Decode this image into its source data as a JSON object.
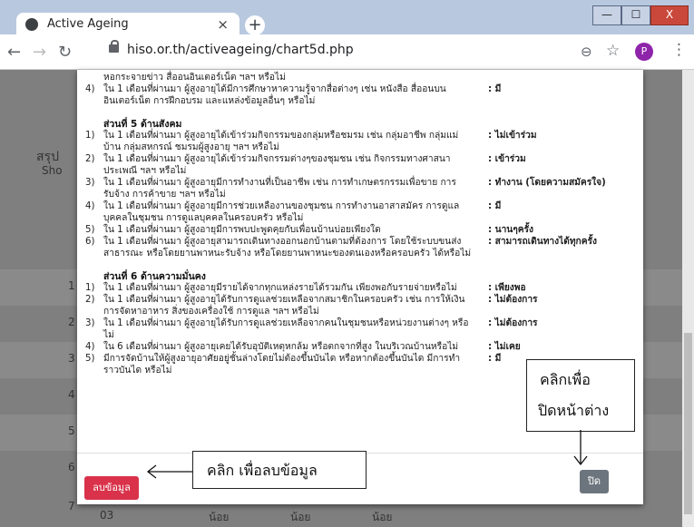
{
  "browser": {
    "tab_title": "Active Ageing",
    "tab_close": "×",
    "new_tab": "+",
    "url": "hiso.or.th/activeageing/chart5d.php",
    "profile_initial": "P",
    "win_min": "—",
    "win_max": "☐",
    "win_close": "X"
  },
  "background": {
    "side_label": "สรุป",
    "show_label": "Sho"
  },
  "modal": {
    "top_rows": [
      {
        "num": "",
        "text": "หอกระจายข่าว สื่ออนอินเตอร์เน็ต ฯลฯ หรือไม่",
        "answer": ""
      },
      {
        "num": "4)",
        "text": "ใน 1 เดือนที่ผ่านมา ผู้สูงอายุได้มีการศึกษาหาความรู้จากสื่อต่างๆ เช่น หนังสือ สื่ออนบน",
        "answer": ": มี"
      },
      {
        "num": "",
        "text": "อินเตอร์เน็ต การฝึกอบรม และแหล่งข้อมูลอื่นๆ หรือไม่",
        "answer": ""
      }
    ],
    "section5": {
      "title": "ส่วนที่ 5 ด้านสังคม",
      "rows": [
        {
          "num": "1)",
          "text": "ใน 1 เดือนที่ผ่านมา ผู้สูงอายุได้เข้าร่วมกิจกรรมของกลุ่มหรือชมรม เช่น กลุ่มอาชีพ กลุ่มแม่",
          "answer": ": ไม่เข้าร่วม"
        },
        {
          "num": "",
          "text": "บ้าน กลุ่มสหกรณ์ ชมรมผู้สูงอายุ ฯลฯ หรือไม่",
          "answer": ""
        },
        {
          "num": "2)",
          "text": "ใน 1 เดือนที่ผ่านมา ผู้สูงอายุได้เข้าร่วมกิจกรรมต่างๆของชุมชน เช่น กิจกรรมทางศาสนา",
          "answer": ": เข้าร่วม"
        },
        {
          "num": "",
          "text": "ประเพณี ฯลฯ หรือไม่",
          "answer": ""
        },
        {
          "num": "3)",
          "text": "ใน 1 เดือนที่ผ่านมา ผู้สูงอายุมีการทำงานที่เป็นอาชีพ เช่น การทำเกษตรกรรมเพื่อขาย การ",
          "answer": ": ทำงาน (โดยความสมัครใจ)"
        },
        {
          "num": "",
          "text": "รับจ้าง การค้าขาย ฯลฯ หรือไม่",
          "answer": ""
        },
        {
          "num": "4)",
          "text": "ใน 1 เดือนที่ผ่านมา ผู้สูงอายุมีการช่วยเหลืองานของชุมชน การทำงานอาสาสมัคร การดูแล",
          "answer": ": มี"
        },
        {
          "num": "",
          "text": "บุคคลในชุมชน การดูแลบุคคลในครอบครัว หรือไม่",
          "answer": ""
        },
        {
          "num": "5)",
          "text": "ใน 1 เดือนที่ผ่านมา ผู้สูงอายุมีการพบปะพูดคุยกับเพื่อนบ้านบ่อยเพียงใด",
          "answer": ": นานๆครั้ง"
        },
        {
          "num": "6)",
          "text": "ใน 1 เดือนที่ผ่านมา ผู้สูงอายุสามารถเดินทางออกนอกบ้านตามที่ต้องการ โดยใช้ระบบขนส่ง",
          "answer": ": สามารถเดินทางได้ทุกครั้ง"
        },
        {
          "num": "",
          "text": "สาธารณะ หรือโดยยานพาหนะรับจ้าง หรือโดยยานพาหนะของตนเองหรือครอบครัว ได้หรือไม่",
          "answer": ""
        }
      ]
    },
    "section6": {
      "title": "ส่วนที่ 6 ด้านความมั่นคง",
      "rows": [
        {
          "num": "1)",
          "text": "ใน 1 เดือนที่ผ่านมา ผู้สูงอายุมีรายได้จากทุกแหล่งรายได้รวมกัน เพียงพอกับรายจ่ายหรือไม่",
          "answer": ": เพียงพอ"
        },
        {
          "num": "2)",
          "text": "ใน 1 เดือนที่ผ่านมา ผู้สูงอายุได้รับการดูแลช่วยเหลือจากสมาชิกในครอบครัว เช่น การให้เงิน",
          "answer": ": ไม่ต้องการ"
        },
        {
          "num": "",
          "text": "การจัดหาอาหาร สิ่งของเครื่องใช้ การดูแล ฯลฯ หรือไม่",
          "answer": ""
        },
        {
          "num": "3)",
          "text": "ใน 1 เดือนที่ผ่านมา ผู้สูงอายุได้รับการดูแลช่วยเหลือจากคนในชุมชนหรือหน่วยงานต่างๆ หรือ",
          "answer": ": ไม่ต้องการ"
        },
        {
          "num": "",
          "text": "ไม่",
          "answer": ""
        },
        {
          "num": "4)",
          "text": "ใน 6 เดือนที่ผ่านมา ผู้สูงอายุเคยได้รับอุบัติเหตุหกล้ม หรือตกจากที่สูง ในบริเวณบ้านหรือไม่",
          "answer": ": ไม่เคย"
        },
        {
          "num": "5)",
          "text": "มีการจัดบ้านให้ผู้สูงอายุอาศัยอยู่ชั้นล่างโดยไม่ต้องขึ้นบันได หรือหากต้องขึ้นบันได มีการทำ",
          "answer": ": มี"
        },
        {
          "num": "",
          "text": "ราวบันได หรือไม่",
          "answer": ""
        }
      ]
    },
    "delete_button": "ลบข้อมูล",
    "close_button": "ปิด"
  },
  "annotations": {
    "delete_note": "คลิก เพื่อลบข้อมูล",
    "close_note_line1": "คลิกเพื่อ",
    "close_note_line2": "ปิดหน้าต่าง"
  },
  "background_table": {
    "row_numbers": [
      "1",
      "2",
      "3",
      "4",
      "5",
      "6",
      "7"
    ],
    "bottom_cells": [
      "03",
      "น้อย",
      "น้อย",
      "น้อย"
    ]
  }
}
